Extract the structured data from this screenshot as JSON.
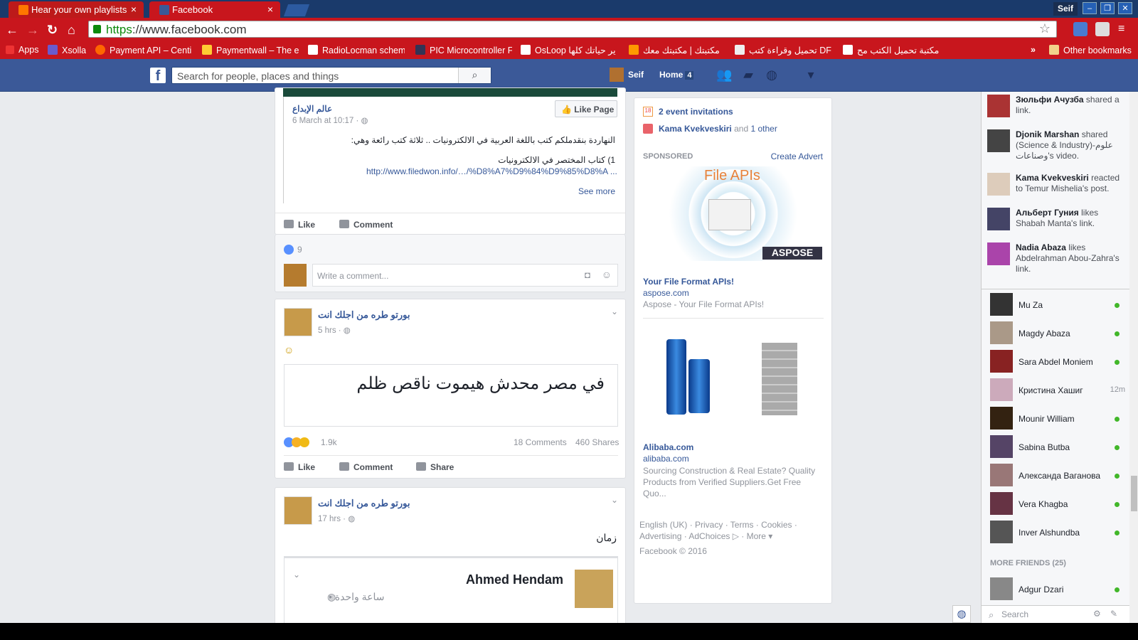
{
  "browser": {
    "tabs": [
      {
        "label": "Hear your own playlists"
      },
      {
        "label": "Facebook"
      }
    ],
    "profile": "Seif",
    "url_scheme": "https",
    "url_rest": "://www.facebook.com",
    "bookmarks": [
      {
        "label": "Apps"
      },
      {
        "label": "Xsolla"
      },
      {
        "label": "Payment API – Centi"
      },
      {
        "label": "Paymentwall – The e"
      },
      {
        "label": "RadioLocman schem"
      },
      {
        "label": "PIC Microcontroller F"
      },
      {
        "label": "OsLoop ير حياتك كلها"
      },
      {
        "label": "مكتبتك | مكتبتك معك"
      },
      {
        "label": "تحميل وقراءة كتب DF"
      },
      {
        "label": "مكتبة تحميل الكتب مح"
      },
      {
        "label": "»"
      },
      {
        "label": "Other bookmarks"
      }
    ]
  },
  "fb": {
    "search_placeholder": "Search for people, places and things",
    "user_name": "Seif",
    "home_label": "Home",
    "home_count": "4"
  },
  "post1": {
    "page_name": "عالم الإبداع",
    "time": "6 March at 10:17 · ",
    "like_page": "Like Page",
    "line1": "النهاردة بنقدملكم كتب باللغة العربية في الالكترونيات .. ثلاثة كتب رائعة وهي:",
    "line2": "1) كتاب المختصر في الالكترونيات",
    "link": "http://www.filedwon.info/…/%D8%A7%D9%84%D9%85%D8%A ...",
    "see_more": "See more",
    "like": "Like",
    "comment": "Comment",
    "reactions": "9",
    "comment_placeholder": "Write a comment..."
  },
  "post2": {
    "author": "بورتو طره من اجلك انت",
    "time": "5 hrs · ",
    "emoji": "☺",
    "text": "في مصر محدش هيموت ناقص ظلم",
    "reactions": "1.9k",
    "comments": "18 Comments",
    "shares": "460 Shares",
    "like": "Like",
    "comment": "Comment",
    "share": "Share"
  },
  "post3": {
    "author": "بورتو طره من اجلك انت",
    "time": "17 hrs · ",
    "text": "زمان",
    "shared_author": "Ahmed Hendam",
    "shared_time": "ساعة واحدة •"
  },
  "rightcol": {
    "event_invites": "2 event invitations",
    "bday_name": "Kama Kvekveskiri",
    "bday_and": "and",
    "bday_other": "1 other",
    "sponsored": "SPONSORED",
    "create_advert": "Create Advert",
    "ad1_banner": "File APIs",
    "ad1_brand": "ASPOSE",
    "ad1_title": "Your File Format APIs!",
    "ad1_domain": "aspose.com",
    "ad1_desc": "Aspose - Your File Format APIs!",
    "ad2_title": "Alibaba.com",
    "ad2_domain": "alibaba.com",
    "ad2_desc": "Sourcing Construction & Real Estate? Quality Products from Verified Suppliers.Get Free Quo...",
    "footer_line1": "English (UK) · Privacy · Terms · Cookies ·",
    "footer_line2": "Advertising · AdChoices ▷ · More ▾",
    "copyright": "Facebook © 2016"
  },
  "ticker": [
    {
      "name": "Зюльфи Ачузба",
      "rest": " shared a link."
    },
    {
      "name": "Djonik Marshan",
      "rest": " shared (Science & Industry)-علوم وصناعات's video."
    },
    {
      "name": "Kama Kvekveskiri",
      "rest": " reacted to Temur Mishelia's post."
    },
    {
      "name": "Альберт Гуния",
      "rest": " likes Shabah Manta's link."
    },
    {
      "name": "Nadia Abaza",
      "rest": " likes Abdelrahman Abou-Zahra's link."
    }
  ],
  "friends": [
    {
      "name": "Mu Za",
      "status": "online"
    },
    {
      "name": "Magdy Abaza",
      "status": "online"
    },
    {
      "name": "Sara Abdel Moniem",
      "status": "online"
    },
    {
      "name": "Кристина Хашиг",
      "status": "12m"
    },
    {
      "name": "Mounir William",
      "status": "online"
    },
    {
      "name": "Sabina Butba",
      "status": "online"
    },
    {
      "name": "Александа Ваганова",
      "status": "online"
    },
    {
      "name": "Vera Khagba",
      "status": "online"
    },
    {
      "name": "Inver Alshundba",
      "status": "online"
    }
  ],
  "more_friends": "MORE FRIENDS (25)",
  "more_friend": {
    "name": "Adgur Dzari"
  },
  "chat_search": "Search"
}
